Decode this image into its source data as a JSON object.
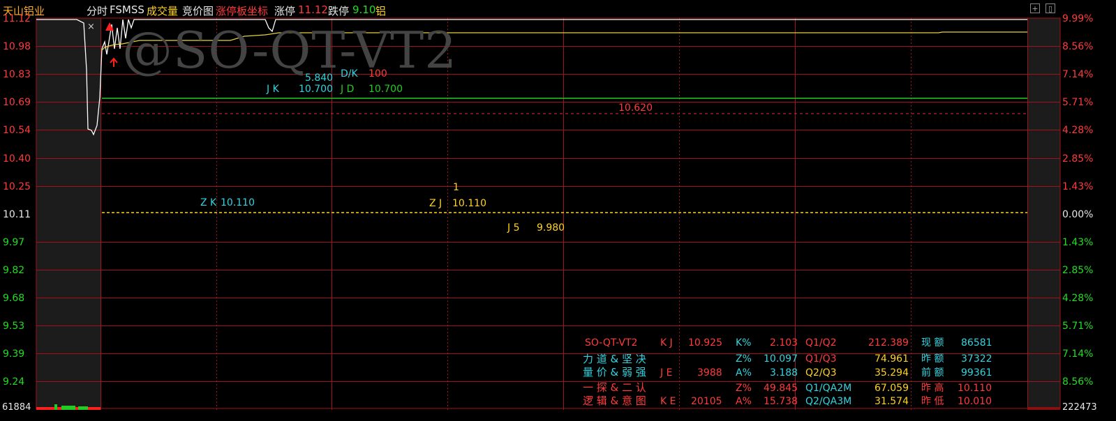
{
  "toolbar": {
    "stock_name": "天山铝业",
    "tab_fenshi": "分时",
    "tab_fsmss": "FSMSS",
    "tab_volume": "成交量",
    "tab_auction": "竞价图",
    "tab_limitup": "涨停板坐标",
    "limit_up_label": "涨停",
    "limit_up_value": "11.12",
    "limit_down_label": "跌停",
    "limit_down_value": "9.10",
    "sector": "铝"
  },
  "watermark": "@SO-QT-VT2",
  "close_glyph": "×",
  "axis_left": [
    "11.12",
    "10.98",
    "10.83",
    "10.69",
    "10.54",
    "10.40",
    "10.25",
    "10.11",
    "9.97",
    "9.82",
    "9.68",
    "9.53",
    "9.39",
    "9.24"
  ],
  "axis_right": [
    "9.99%",
    "8.56%",
    "7.14%",
    "5.71%",
    "4.28%",
    "2.85%",
    "1.43%",
    "0.00%",
    "1.43%",
    "2.85%",
    "4.28%",
    "5.71%",
    "7.14%",
    "8.56%"
  ],
  "volume_left": "61884",
  "volume_right": "222473",
  "annotations": {
    "dk_value": "5.840",
    "dk_label": "D/K",
    "dk_count": "100",
    "jk_label": "J K",
    "jk_value": "10.700",
    "jd_label": "J D",
    "jd_value": "10.700",
    "ref_value": "10.620",
    "zk_label": "Z K",
    "zk_value": "10.110",
    "zj_label": "Z J",
    "zj_value": "10.110",
    "zj_mark": "1",
    "j5_label": "J 5",
    "j5_value": "9.980"
  },
  "info_panel": {
    "r1": {
      "a": "SO-QT-VT2",
      "b": "K J",
      "c": "10.925",
      "d": "K%",
      "e": "2.103",
      "f": "Q1/Q2",
      "g": "212.389",
      "h": "现 额",
      "i": "86581"
    },
    "r2": {
      "a": "力 道 & 坚 决",
      "d": "Z%",
      "e": "10.097",
      "f": "Q1/Q3",
      "g": "74.961",
      "h": "昨 额",
      "i": "37322"
    },
    "r3": {
      "a": "量 价 & 弱 强",
      "b": "J E",
      "c": "3988",
      "d": "A%",
      "e": "3.188",
      "f": "Q2/Q3",
      "g": "35.294",
      "h": "前 额",
      "i": "99361"
    },
    "r4": {
      "a": "一 探 & 二 认",
      "d": "Z%",
      "e": "49.845",
      "f": "Q1/QA2M",
      "g": "67.059",
      "h": "昨 高",
      "i": "10.110"
    },
    "r5": {
      "a": "逻 辑 & 意 图",
      "b": "K E",
      "c": "20105",
      "d": "A%",
      "e": "15.738",
      "f": "Q2/QA3M",
      "g": "31.574",
      "h": "昨 低",
      "i": "10.010"
    }
  },
  "colors": {
    "grid_red": "#a0141e",
    "up": "#ff3b3b",
    "down": "#22cc22",
    "cyan": "#2fd5e0",
    "yellow": "#ffd21e",
    "price_line": "#ffffff",
    "avg_line": "#e6d23a"
  }
}
